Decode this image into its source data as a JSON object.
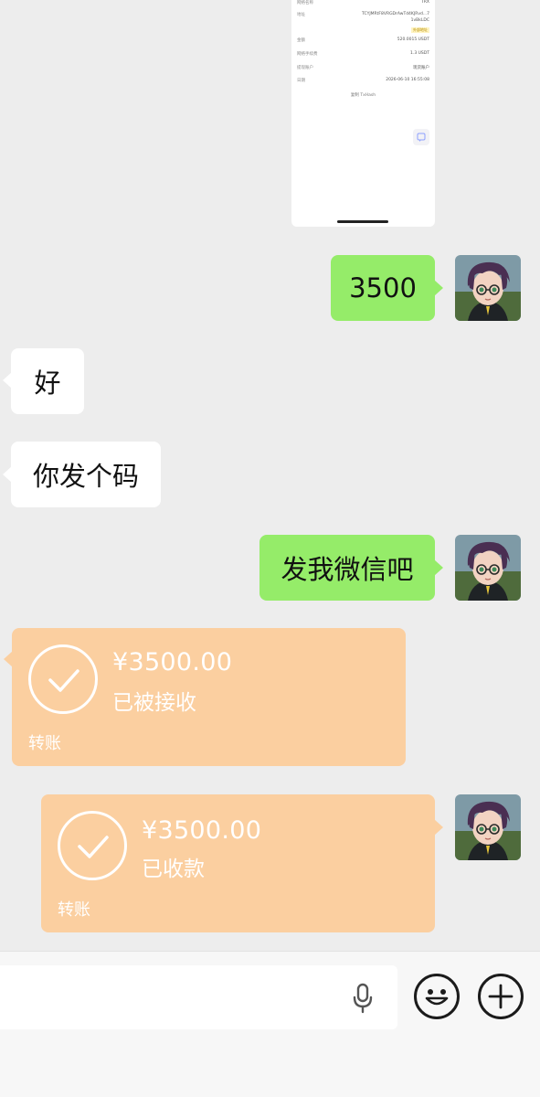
{
  "shared_image": {
    "rows": [
      {
        "key": "网络名称",
        "value": "TRX"
      },
      {
        "key": "地址",
        "value": "TCYJMRtF8VRGDrAwTd4KJRvd...7 "
      },
      {
        "key": "",
        "value": "1vBkLDC"
      },
      {
        "key": "金额",
        "value": "520.0015 USDT"
      },
      {
        "key": "网络手续费",
        "value": "1.3 USDT"
      },
      {
        "key": "提现账户",
        "value": "现货账户"
      },
      {
        "key": "日期",
        "value": "2026-06-10 16:55:08"
      }
    ],
    "tag": "外部地址",
    "link": "复制 TxHash"
  },
  "messages": [
    {
      "side": "me",
      "text": "3500"
    },
    {
      "side": "them",
      "text": "好"
    },
    {
      "side": "them",
      "text": "你发个码"
    },
    {
      "side": "me",
      "text": "发我微信吧"
    }
  ],
  "transfers": [
    {
      "side": "them",
      "amount": "¥3500.00",
      "status": "已被接收",
      "label": "转账"
    },
    {
      "side": "me",
      "amount": "¥3500.00",
      "status": "已收款",
      "label": "转账"
    }
  ],
  "bottom_bar": {
    "voice_icon": "microphone-icon",
    "emoji_icon": "emoji-smile-icon",
    "plus_icon": "plus-icon"
  },
  "colors": {
    "background": "#ededed",
    "my_bubble": "#95ec69",
    "their_bubble": "#ffffff",
    "transfer_card": "#fbcfa0"
  }
}
